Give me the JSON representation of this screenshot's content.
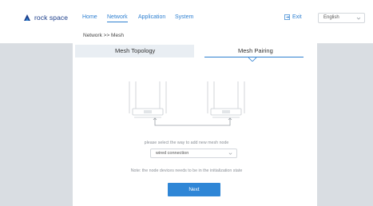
{
  "header": {
    "logo_text": "rock space",
    "nav": [
      {
        "label": "Home"
      },
      {
        "label": "Network"
      },
      {
        "label": "Application"
      },
      {
        "label": "System"
      }
    ],
    "active_nav": "Network",
    "exit_label": "Exit",
    "language": {
      "selected": "English"
    }
  },
  "breadcrumb": "Network >> Mesh",
  "tabs": [
    {
      "label": "Mesh Topology"
    },
    {
      "label": "Mesh Pairing"
    }
  ],
  "active_tab": "Mesh Pairing",
  "pairing": {
    "hint": "please select the way to add new mesh node",
    "method": {
      "selected": "wired connection"
    },
    "note": "Note: the node devices needs to be in the initialization state",
    "next_label": "Next"
  },
  "colors": {
    "accent": "#2f80d1",
    "button": "#2f86d6",
    "background": "#d9dde2",
    "tab_inactive": "#e9eef3"
  },
  "icons": {
    "logo": "rock-space-logo",
    "exit": "exit-icon",
    "language_chevron": "chevron-down-icon",
    "select_chevron": "chevron-down-icon",
    "diagram": "router-icon"
  }
}
